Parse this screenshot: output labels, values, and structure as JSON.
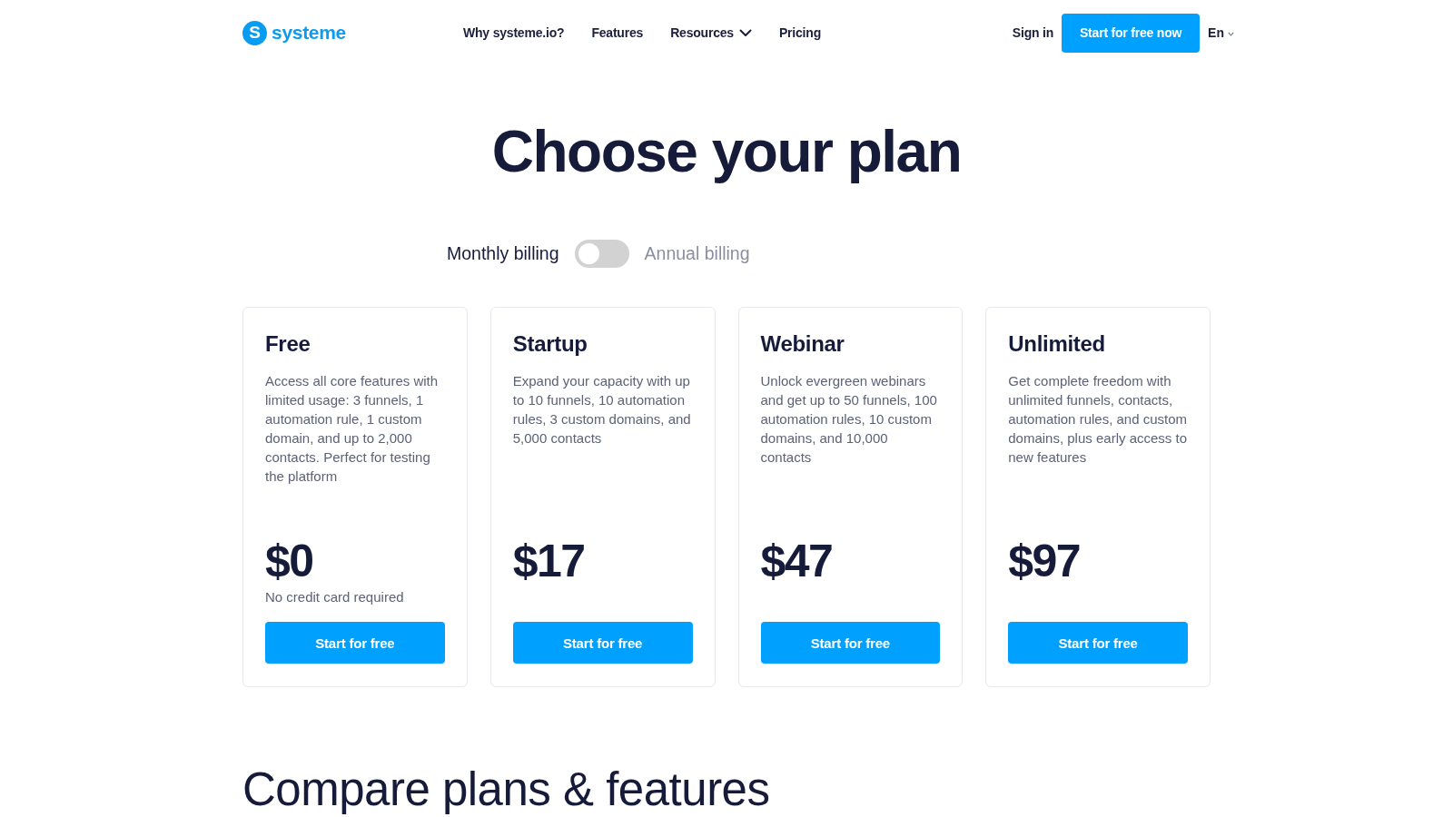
{
  "header": {
    "logo": {
      "mark": "S",
      "text": "systeme"
    },
    "nav": [
      {
        "label": "Why systeme.io?",
        "has_menu": false
      },
      {
        "label": "Features",
        "has_menu": false
      },
      {
        "label": "Resources",
        "has_menu": true
      },
      {
        "label": "Pricing",
        "has_menu": false
      }
    ],
    "sign_in": "Sign in",
    "cta": "Start for free now",
    "language": "En"
  },
  "hero": {
    "title": "Choose your plan"
  },
  "billing_toggle": {
    "left_label": "Monthly billing",
    "right_label": "Annual billing",
    "on": false
  },
  "plans": [
    {
      "name": "Free",
      "description": "Access all core features with limited usage: 3 funnels, 1 automation rule, 1 custom domain, and up to 2,000 contacts. Perfect for testing the platform",
      "price": "$0",
      "note": "No credit card required",
      "button": "Start for free"
    },
    {
      "name": "Startup",
      "description": "Expand your capacity with up to 10 funnels, 10 automation rules, 3 custom domains, and 5,000 contacts",
      "price": "$17",
      "button": "Start for free"
    },
    {
      "name": "Webinar",
      "description": "Unlock evergreen webinars and get up to 50 funnels, 100 automation rules, 10 custom domains, and 10,000 contacts",
      "price": "$47",
      "button": "Start for free"
    },
    {
      "name": "Unlimited",
      "description": "Get complete freedom with unlimited funnels, contacts, automation rules, and custom domains, plus early access to new features",
      "price": "$97",
      "button": "Start for free"
    }
  ],
  "compare": {
    "title": "Compare plans & features"
  }
}
